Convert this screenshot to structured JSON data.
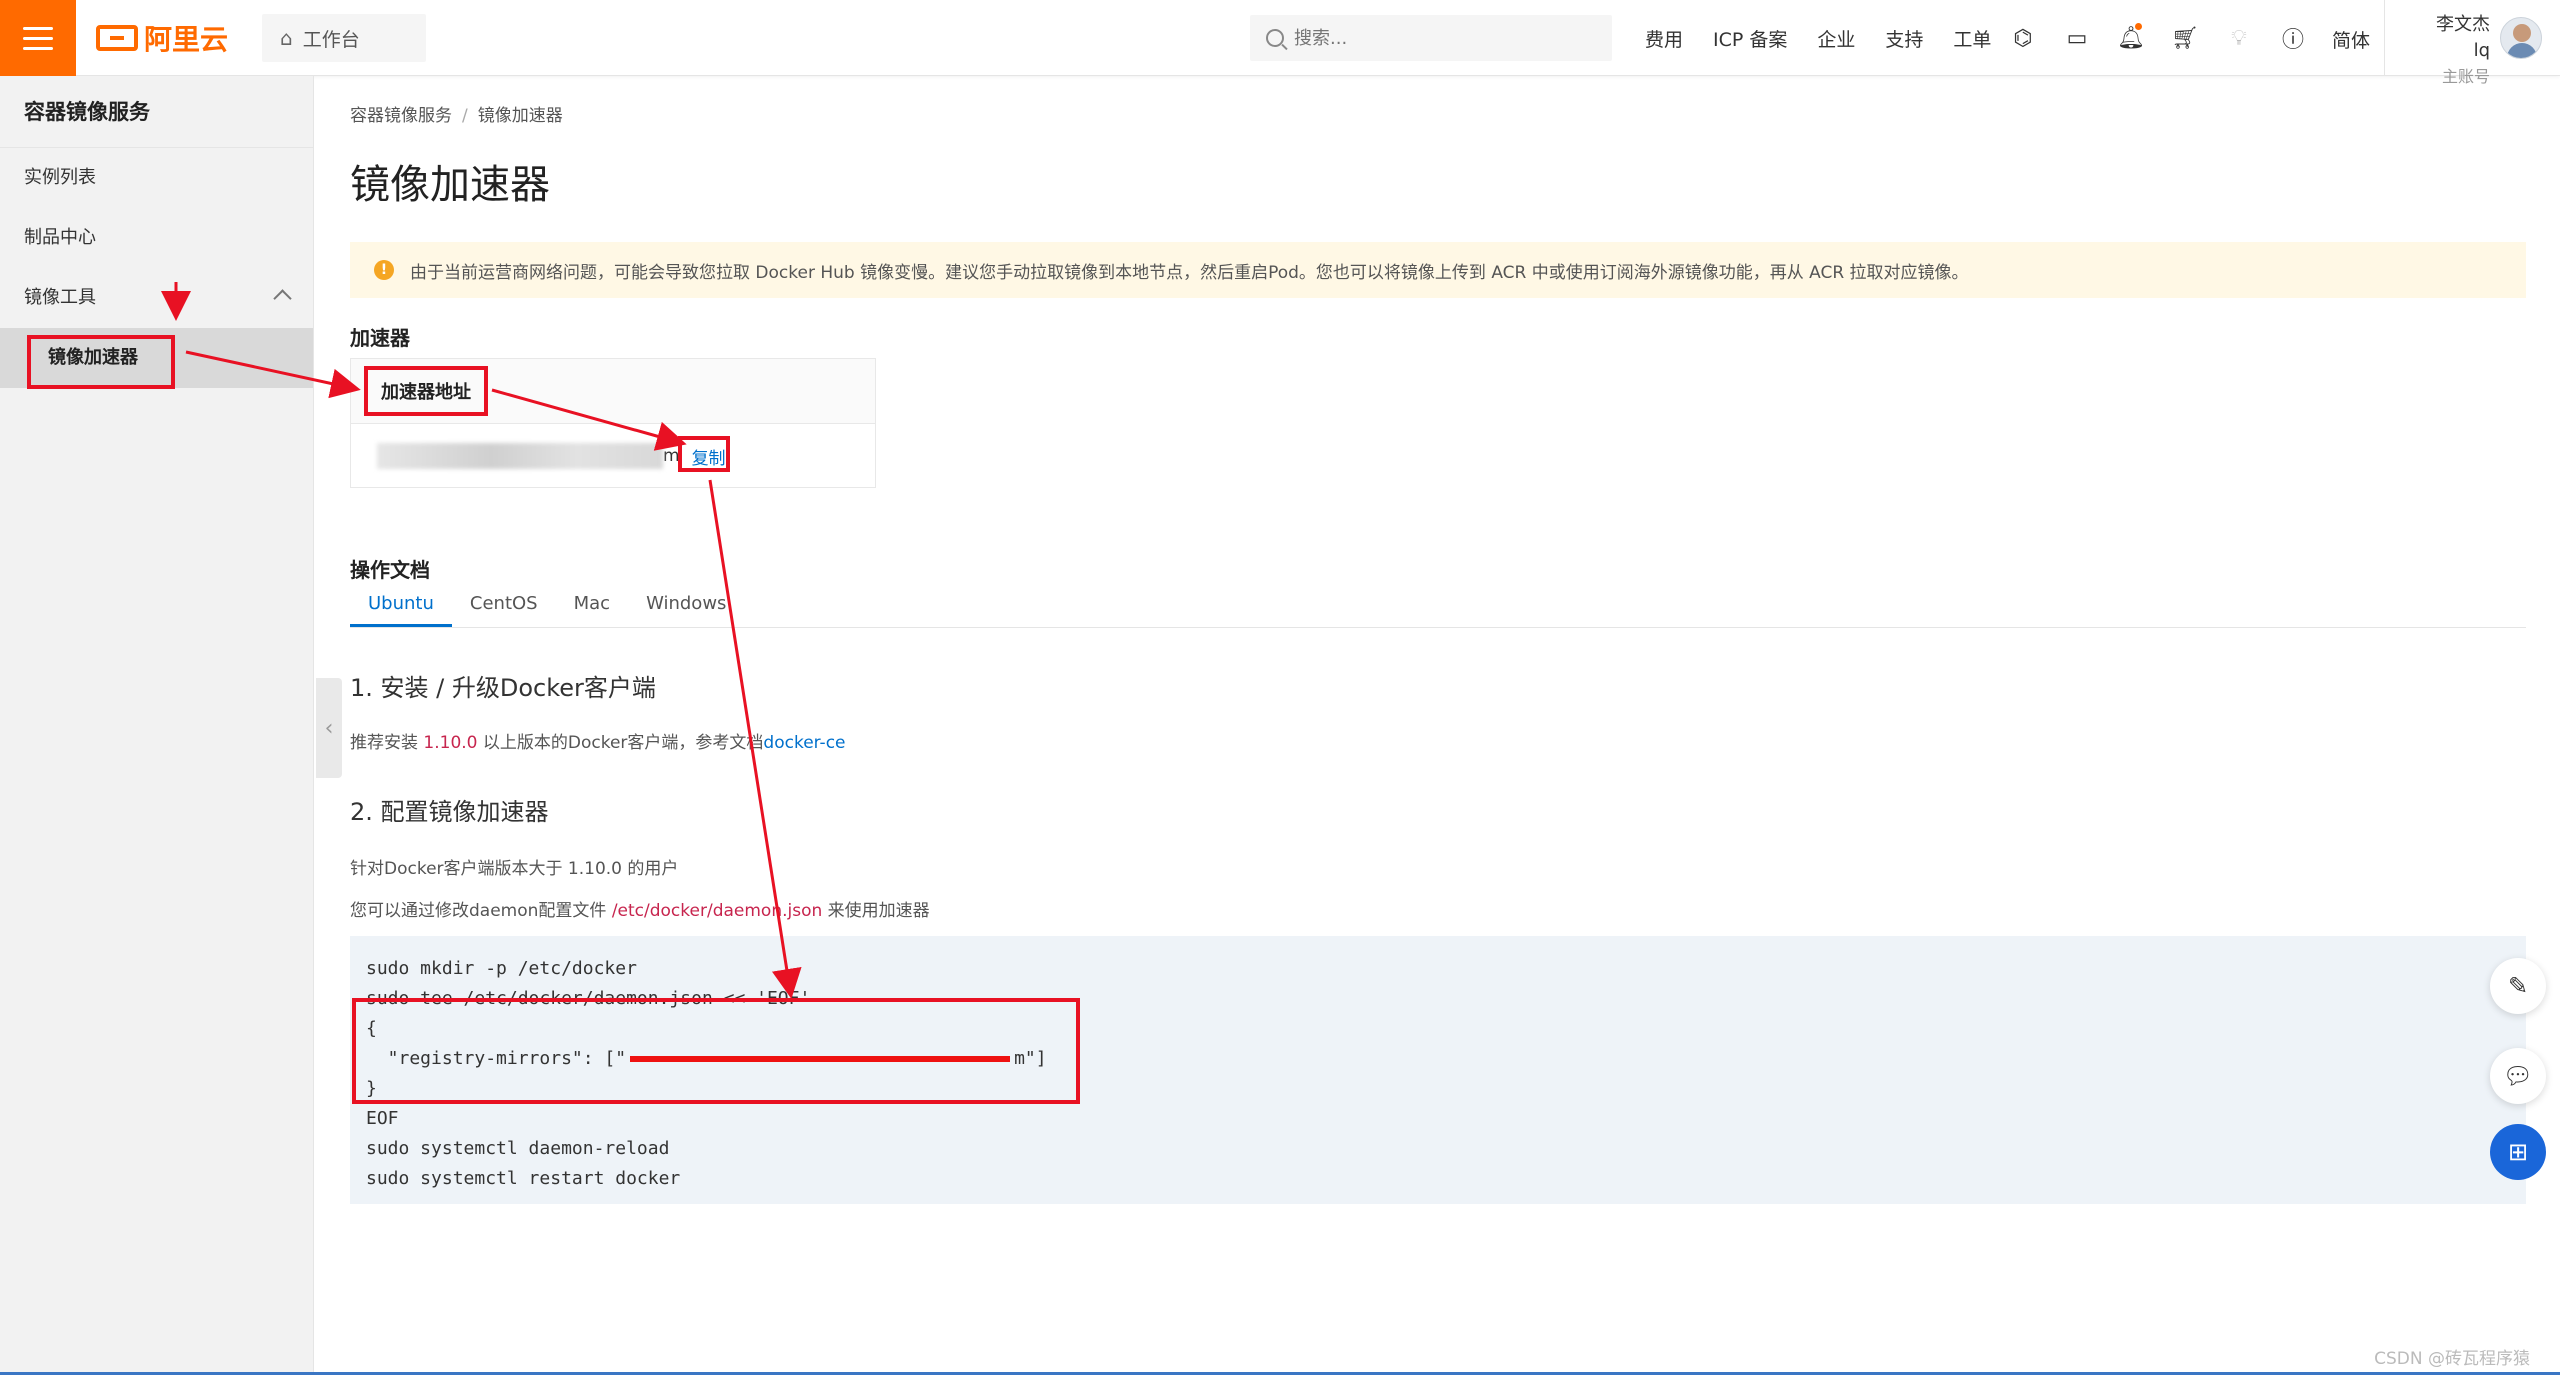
{
  "topbar": {
    "logo_text": "阿里云",
    "workbench": "工作台",
    "search_placeholder": "搜索...",
    "links": [
      "费用",
      "ICP 备案",
      "企业",
      "支持",
      "工单"
    ],
    "lang": "简体",
    "user_name": "李文杰lq",
    "user_sub": "主账号"
  },
  "sidebar": {
    "title": "容器镜像服务",
    "items": [
      "实例列表",
      "制品中心"
    ],
    "group": "镜像工具",
    "sub_item": "镜像加速器"
  },
  "main": {
    "breadcrumb": [
      "容器镜像服务",
      "镜像加速器"
    ],
    "title": "镜像加速器",
    "notice": "由于当前运营商网络问题，可能会导致您拉取 Docker Hub 镜像变慢。建议您手动拉取镜像到本地节点，然后重启Pod。您也可以将镜像上传到 ACR 中或使用订阅海外源镜像功能，再从 ACR 拉取对应镜像。",
    "accelerator_heading": "加速器",
    "table_header": "加速器地址",
    "address_suffix": "m",
    "copy": "复制",
    "docs_heading": "操作文档",
    "tabs": [
      "Ubuntu",
      "CentOS",
      "Mac",
      "Windows"
    ],
    "step1_title": "1. 安装 / 升级Docker客户端",
    "step1_pre": "推荐安装 ",
    "step1_version": "1.10.0",
    "step1_mid": " 以上版本的Docker客户端，参考文档",
    "step1_link": "docker-ce",
    "step2_title": "2. 配置镜像加速器",
    "step2_line1": "针对Docker客户端版本大于 1.10.0 的用户",
    "step2_line2_pre": "您可以通过修改daemon配置文件 ",
    "step2_path": "/etc/docker/daemon.json",
    "step2_line2_post": " 来使用加速器",
    "code_lines": {
      "l1": "sudo mkdir -p /etc/docker",
      "l2": "sudo tee /etc/docker/daemon.json <<-'EOF'",
      "l3": "{",
      "l4_pre": "  \"registry-mirrors\": [\"",
      "l4_post": "m\"]",
      "l5": "}",
      "l6": "EOF",
      "l7": "sudo systemctl daemon-reload",
      "l8": "sudo systemctl restart docker"
    }
  },
  "watermark": "CSDN @砖瓦程序猿",
  "colors": {
    "brand": "#ff6a00",
    "link": "#0070cc",
    "annotation": "#e81123"
  }
}
